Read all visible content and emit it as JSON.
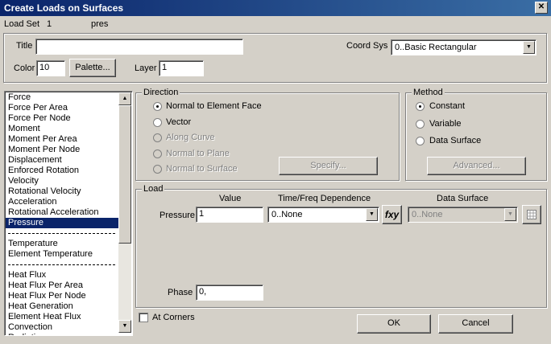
{
  "window": {
    "title": "Create Loads on Surfaces",
    "close_glyph": "✕"
  },
  "header": {
    "load_set_label": "Load Set",
    "load_set_value": "1",
    "load_set_name": "pres"
  },
  "top": {
    "title_label": "Title",
    "title_value": "",
    "coord_sys_label": "Coord Sys",
    "coord_sys_value": "0..Basic Rectangular",
    "color_label": "Color",
    "color_value": "10",
    "palette_label": "Palette...",
    "layer_label": "Layer",
    "layer_value": "1"
  },
  "load_types": {
    "items": [
      "Force",
      "Force Per Area",
      "Force Per Node",
      "Moment",
      "Moment Per Area",
      "Moment Per Node",
      "Displacement",
      "Enforced Rotation",
      "Velocity",
      "Rotational Velocity",
      "Acceleration",
      "Rotational Acceleration",
      "Pressure",
      "",
      "Temperature",
      "Element Temperature",
      "",
      "Heat Flux",
      "Heat Flux Per Area",
      "Heat Flux Per Node",
      "Heat Generation",
      "Element Heat Flux",
      "Convection",
      "Radiation"
    ],
    "selected": "Pressure"
  },
  "direction": {
    "label": "Direction",
    "options": [
      {
        "label": "Normal to Element Face",
        "selected": true,
        "enabled": true
      },
      {
        "label": "Vector",
        "selected": false,
        "enabled": true
      },
      {
        "label": "Along Curve",
        "selected": false,
        "enabled": false
      },
      {
        "label": "Normal to Plane",
        "selected": false,
        "enabled": false
      },
      {
        "label": "Normal to Surface",
        "selected": false,
        "enabled": false
      }
    ],
    "specify_label": "Specify..."
  },
  "method": {
    "label": "Method",
    "options": [
      {
        "label": "Constant",
        "selected": true
      },
      {
        "label": "Variable",
        "selected": false
      },
      {
        "label": "Data Surface",
        "selected": false
      }
    ],
    "advanced_label": "Advanced..."
  },
  "load": {
    "label": "Load",
    "col_value": "Value",
    "col_time": "Time/Freq Dependence",
    "col_surface": "Data Surface",
    "pressure_label": "Pressure",
    "pressure_value": "1",
    "time_value": "0..None",
    "fxy_label": "fxy",
    "surface_value": "0..None",
    "phase_label": "Phase",
    "phase_value": "0,"
  },
  "bottom": {
    "at_corners_label": "At Corners",
    "ok_label": "OK",
    "cancel_label": "Cancel"
  }
}
